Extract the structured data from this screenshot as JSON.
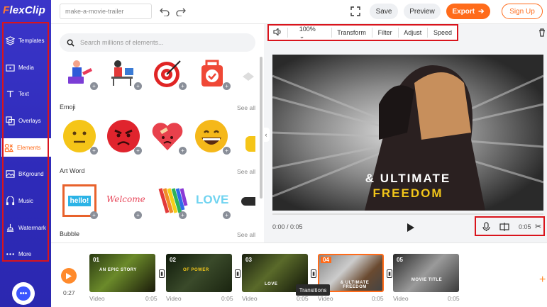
{
  "app": {
    "logo_prefix": "F",
    "logo_rest": "lexClip"
  },
  "sidebar": {
    "items": [
      {
        "label": "Templates",
        "icon": "layers-icon"
      },
      {
        "label": "Media",
        "icon": "folder-icon"
      },
      {
        "label": "Text",
        "icon": "text-icon"
      },
      {
        "label": "Overlays",
        "icon": "overlay-icon"
      },
      {
        "label": "Elements",
        "icon": "elements-icon"
      },
      {
        "label": "BKground",
        "icon": "background-icon"
      },
      {
        "label": "Music",
        "icon": "music-icon"
      },
      {
        "label": "Watermark",
        "icon": "watermark-icon"
      },
      {
        "label": "More",
        "icon": "more-icon"
      }
    ],
    "active": "Elements",
    "help_icon": "chat-icon"
  },
  "header": {
    "project_name": "make-a-movie-trailer",
    "save_label": "Save",
    "preview_label": "Preview",
    "export_label": "Export",
    "signup_label": "Sign Up"
  },
  "panel": {
    "search_placeholder": "Search millions of elements...",
    "sections": {
      "emoji": {
        "title": "Emoji",
        "see_all": "See all"
      },
      "art_word": {
        "title": "Art Word",
        "see_all": "See all"
      },
      "bubble": {
        "title": "Bubble",
        "see_all": "See all"
      }
    },
    "art_words": {
      "hello": "hello!",
      "welcome": "Welcome",
      "love": "LOVE"
    }
  },
  "toolbar": {
    "volume": "100%",
    "transform": "Transform",
    "filter": "Filter",
    "adjust": "Adjust",
    "speed": "Speed"
  },
  "video": {
    "overlay_line1": "& ULTIMATE",
    "overlay_line2": "FREEDOM",
    "time": "0:00 / 0:05",
    "duration": "0:05"
  },
  "timeline": {
    "total_time": "0:27",
    "tooltip": "Transitions",
    "clips": [
      {
        "num": "01",
        "label": "Video",
        "dur": "0:05",
        "caption": "AN EPIC STORY"
      },
      {
        "num": "02",
        "label": "Video",
        "dur": "0:05",
        "caption": "OF POWER"
      },
      {
        "num": "03",
        "label": "Video",
        "dur": "0:05",
        "caption": "LOVE"
      },
      {
        "num": "04",
        "label": "Video",
        "dur": "0:05",
        "caption": "& ULTIMATE FREEDOM"
      },
      {
        "num": "05",
        "label": "Video",
        "dur": "0:05",
        "caption": "MOVIE TITLE"
      }
    ]
  },
  "colors": {
    "accent": "#ff6b1a",
    "sidebar": "#3a35c9",
    "highlight": "#d9141c"
  }
}
